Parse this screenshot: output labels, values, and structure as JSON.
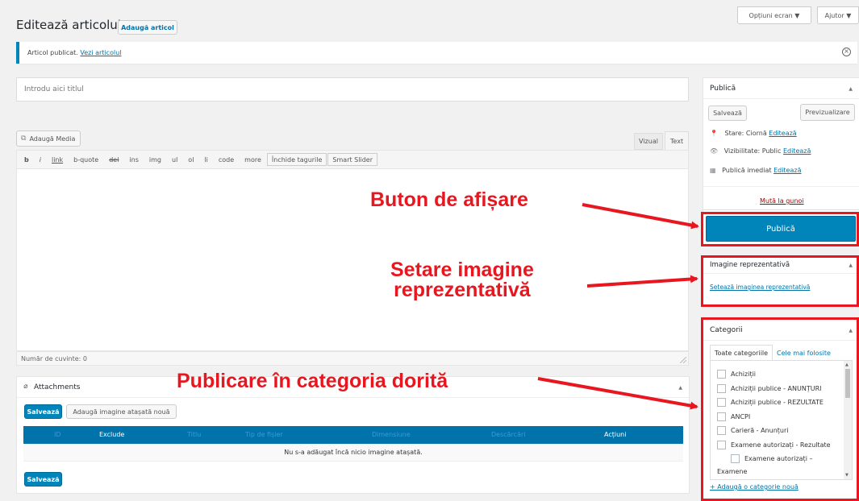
{
  "header": {
    "title": "Editează articolul",
    "add_new": "Adaugă articol",
    "screen_options": "Opțiuni ecran ▼",
    "help": "Ajutor ▼"
  },
  "notice": {
    "text": "Articol publicat.",
    "link": "Vezi articolul"
  },
  "title_input": {
    "placeholder": "Introdu aici titlul"
  },
  "editor": {
    "add_media": "Adaugă Media",
    "tab_visual": "Vizual",
    "tab_text": "Text",
    "quicktags": [
      "b",
      "i",
      "link",
      "b-quote",
      "del",
      "ins",
      "img",
      "ul",
      "ol",
      "li",
      "code",
      "more",
      "Închide tagurile",
      "Smart Slider"
    ],
    "word_count": "Număr de cuvinte: 0"
  },
  "attachments": {
    "title": "Attachments",
    "save": "Salvează",
    "add_new": "Adaugă imagine atașată nouă",
    "columns": [
      "ID",
      "Exclude",
      "Titlu",
      "Tip de fișier",
      "Dimensiune",
      "Descărcări",
      "Acțiuni"
    ],
    "empty": "Nu s-a adăugat încă nicio imagine atașată.",
    "save_bottom": "Salvează"
  },
  "publish": {
    "title": "Publică",
    "save": "Salvează",
    "preview": "Previzualizare",
    "status_label": "Stare: Ciornă",
    "visibility_label": "Vizibilitate: Public",
    "schedule_label": "Publică imediat",
    "edit": "Editează",
    "trash": "Mută la gunoi",
    "publish_button": "Publică"
  },
  "featured": {
    "title": "Imagine reprezentativă",
    "set_link": "Setează imaginea reprezentativă"
  },
  "categories": {
    "title": "Categorii",
    "tab_all": "Toate categoriile",
    "tab_popular": "Cele mai folosite",
    "items": [
      "Achiziții",
      "Achiziții publice - ANUNȚURI",
      "Achiziții publice - REZULTATE",
      "ANCPI",
      "Carieră - Anunțuri",
      "Examene autorizați - Rezultate"
    ],
    "sub_item_line1": "Examene autorizați –",
    "sub_item_line2": "Examene",
    "add_new": "+ Adaugă o categorie nouă"
  },
  "annotations": {
    "publish_button": "Buton de afișare",
    "featured_line1": "Setare imagine",
    "featured_line2": "reprezentativă",
    "category": "Publicare în categoria dorită"
  },
  "colors": {
    "accent": "#0085ba",
    "annotation_red": "#e8161e",
    "table_header": "#0073aa"
  }
}
